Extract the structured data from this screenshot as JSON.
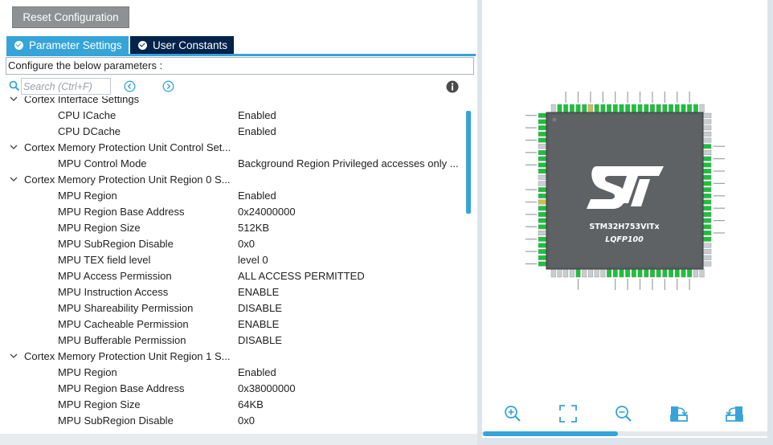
{
  "toolbar": {
    "reset_label": "Reset Configuration"
  },
  "tabs": [
    {
      "label": "Parameter Settings",
      "active": true
    },
    {
      "label": "User Constants",
      "active": false
    }
  ],
  "configure_text": "Configure the below parameters :",
  "search": {
    "placeholder": "Search (Ctrl+F)",
    "value": ""
  },
  "icons": {
    "search": "search-icon",
    "back": "arrow-left-icon",
    "forward": "arrow-right-icon",
    "info": "info-icon",
    "chevron": "chevron-down-icon",
    "zoom_in": "zoom-in-icon",
    "fit": "fit-screen-icon",
    "zoom_out": "zoom-out-icon",
    "rotate_export": "export-icon",
    "rotate_import": "import-icon"
  },
  "colors": {
    "accent": "#36a4d8",
    "tab_dark": "#03234b",
    "reset_bg": "#8e9193",
    "pin_green": "#19c23a",
    "chip_body": "#55585b"
  },
  "tree": [
    {
      "type": "group",
      "label": "Cortex Interface Settings"
    },
    {
      "type": "param",
      "name": "CPU ICache",
      "value": "Enabled"
    },
    {
      "type": "param",
      "name": "CPU DCache",
      "value": "Enabled"
    },
    {
      "type": "group",
      "label": "Cortex Memory Protection Unit Control Set..."
    },
    {
      "type": "param",
      "name": "MPU Control Mode",
      "value": "Background Region Privileged accesses only ..."
    },
    {
      "type": "group",
      "label": "Cortex Memory Protection Unit Region 0 S..."
    },
    {
      "type": "param",
      "name": "MPU Region",
      "value": "Enabled"
    },
    {
      "type": "param",
      "name": "MPU Region Base Address",
      "value": "0x24000000"
    },
    {
      "type": "param",
      "name": "MPU Region Size",
      "value": "512KB"
    },
    {
      "type": "param",
      "name": "MPU SubRegion Disable",
      "value": "0x0"
    },
    {
      "type": "param",
      "name": "MPU TEX field level",
      "value": "level 0"
    },
    {
      "type": "param",
      "name": "MPU Access Permission",
      "value": "ALL ACCESS PERMITTED"
    },
    {
      "type": "param",
      "name": "MPU Instruction Access",
      "value": "ENABLE"
    },
    {
      "type": "param",
      "name": "MPU Shareability Permission",
      "value": "DISABLE"
    },
    {
      "type": "param",
      "name": "MPU Cacheable Permission",
      "value": "ENABLE"
    },
    {
      "type": "param",
      "name": "MPU Bufferable  Permission",
      "value": "DISABLE"
    },
    {
      "type": "group",
      "label": "Cortex Memory Protection Unit Region 1 S..."
    },
    {
      "type": "param",
      "name": "MPU Region",
      "value": "Enabled"
    },
    {
      "type": "param",
      "name": "MPU Region Base Address",
      "value": "0x38000000"
    },
    {
      "type": "param",
      "name": "MPU Region Size",
      "value": "64KB"
    },
    {
      "type": "param",
      "name": "MPU SubRegion Disable",
      "value": "0x0"
    }
  ],
  "chip": {
    "part_number": "STM32H753VITx",
    "package": "LQFP100",
    "logo": "ST"
  }
}
